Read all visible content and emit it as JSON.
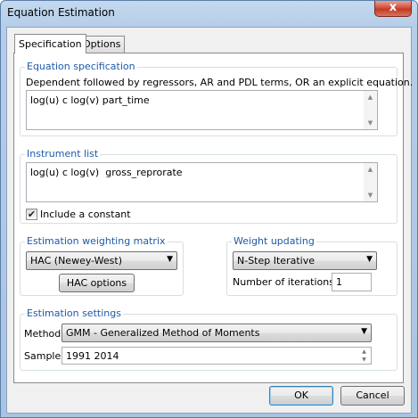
{
  "window": {
    "title": "Equation Estimation",
    "close_glyph": "x"
  },
  "tabs": [
    {
      "label": "Specification"
    },
    {
      "label": "Options"
    }
  ],
  "equation_spec": {
    "legend": "Equation specification",
    "description": "Dependent followed by regressors, AR and PDL terms, OR an explicit equation.",
    "value": "log(u) c log(v) part_time"
  },
  "instrument_list": {
    "legend": "Instrument list",
    "value": "log(u) c log(v)  gross_reprorate",
    "include_constant_label": "Include a constant",
    "include_constant_checked": true
  },
  "weighting_matrix": {
    "legend": "Estimation weighting matrix",
    "selected": "HAC (Newey-West)",
    "options_button": "HAC options"
  },
  "weight_updating": {
    "legend": "Weight updating",
    "selected": "N-Step Iterative",
    "iterations_label": "Number of iterations:",
    "iterations_value": "1"
  },
  "estimation_settings": {
    "legend": "Estimation settings",
    "method_label": "Method:",
    "method_value": "GMM  -  Generalized Method of Moments",
    "sample_label": "Sample:",
    "sample_value": "1991 2014"
  },
  "buttons": {
    "ok": "OK",
    "cancel": "Cancel"
  }
}
